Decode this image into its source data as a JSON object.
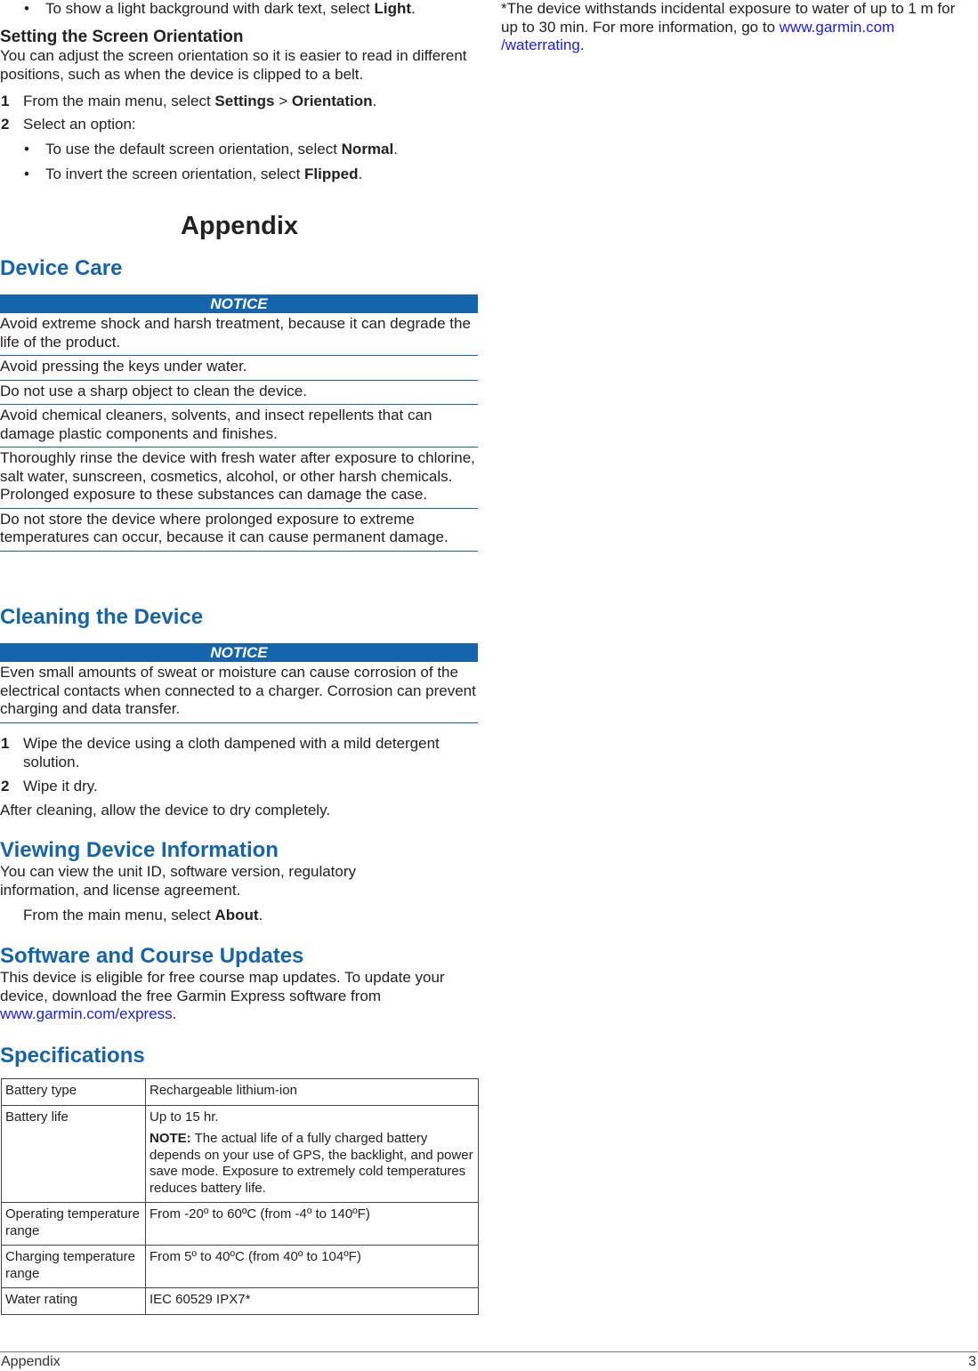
{
  "top": {
    "bullet_light": {
      "pre": "To show a light background with dark text, select ",
      "bold": "Light",
      "post": "."
    },
    "orientation_heading": "Setting the Screen Orientation",
    "orientation_intro": "You can adjust the screen orientation so it is easier to read in different positions, such as when the device is clipped to a belt.",
    "steps": [
      {
        "num": "1",
        "pre": "From the main menu, select ",
        "bold1": "Settings",
        "mid": " > ",
        "bold2": "Orientation",
        "post": "."
      },
      {
        "num": "2",
        "text": "Select an option:"
      }
    ],
    "options": [
      {
        "pre": "To use the default screen orientation, select ",
        "bold": "Normal",
        "post": "."
      },
      {
        "pre": "To invert the screen orientation, select ",
        "bold": "Flipped",
        "post": "."
      }
    ]
  },
  "appendix_title": "Appendix",
  "device_care": {
    "heading": "Device Care",
    "notice_label": "NOTICE",
    "rows": [
      "Avoid extreme shock and harsh treatment, because it can degrade the life of the product.",
      "Avoid pressing the keys under water.",
      "Do not use a sharp object to clean the device.",
      "Avoid chemical cleaners, solvents, and insect repellents that can damage plastic components and finishes.",
      "Thoroughly rinse the device with fresh water after exposure to chlorine, salt water, sunscreen, cosmetics, alcohol, or other harsh chemicals. Prolonged exposure to these substances can damage the case.",
      "Do not store the device where prolonged exposure to extreme temperatures can occur, because it can cause permanent damage."
    ]
  },
  "cleaning": {
    "heading": "Cleaning the Device",
    "notice_label": "NOTICE",
    "notice_text": "Even small amounts of sweat or moisture can cause corrosion of the electrical contacts when connected to a charger. Corrosion can prevent charging and data transfer.",
    "steps": [
      {
        "num": "1",
        "text": "Wipe the device using a cloth dampened with a mild detergent solution."
      },
      {
        "num": "2",
        "text": "Wipe it dry."
      }
    ],
    "after": "After cleaning, allow the device to dry completely."
  },
  "device_info": {
    "heading": "Viewing Device Information",
    "intro": "You can view the unit ID, software version, regulatory information, and license agreement.",
    "step_pre": "From the main menu, select ",
    "step_bold": "About",
    "step_post": "."
  },
  "updates": {
    "heading": "Software and Course Updates",
    "text": "This device is eligible for free course map updates. To update your device, download the free Garmin Express software from ",
    "link": "www.garmin.com/express",
    "post": "."
  },
  "specs": {
    "heading": "Specifications",
    "rows": [
      {
        "key": "Battery type",
        "value": "Rechargeable lithium-ion"
      },
      {
        "key": "Battery life",
        "value": "Up to 15 hr.",
        "note_label": "NOTE:",
        "note": " The actual life of a fully charged battery depends on your use of GPS, the backlight, and power save mode. Exposure to extremely cold temperatures reduces battery life."
      },
      {
        "key": "Operating temperature range",
        "value": "From -20º to 60ºC (from -4º to 140ºF)"
      },
      {
        "key": "Charging temperature range",
        "value": "From 5º to 40ºC (from 40º to 104ºF)"
      },
      {
        "key": "Water rating",
        "value": "IEC 60529 IPX7*"
      }
    ]
  },
  "footnote": {
    "text": "*The device withstands incidental exposure to water of up to 1 m for up to 30 min. For more information, go to ",
    "link_line1": "www.garmin.com",
    "link_line2": "/waterrating",
    "post": "."
  },
  "footer": {
    "section": "Appendix",
    "page": "3"
  }
}
